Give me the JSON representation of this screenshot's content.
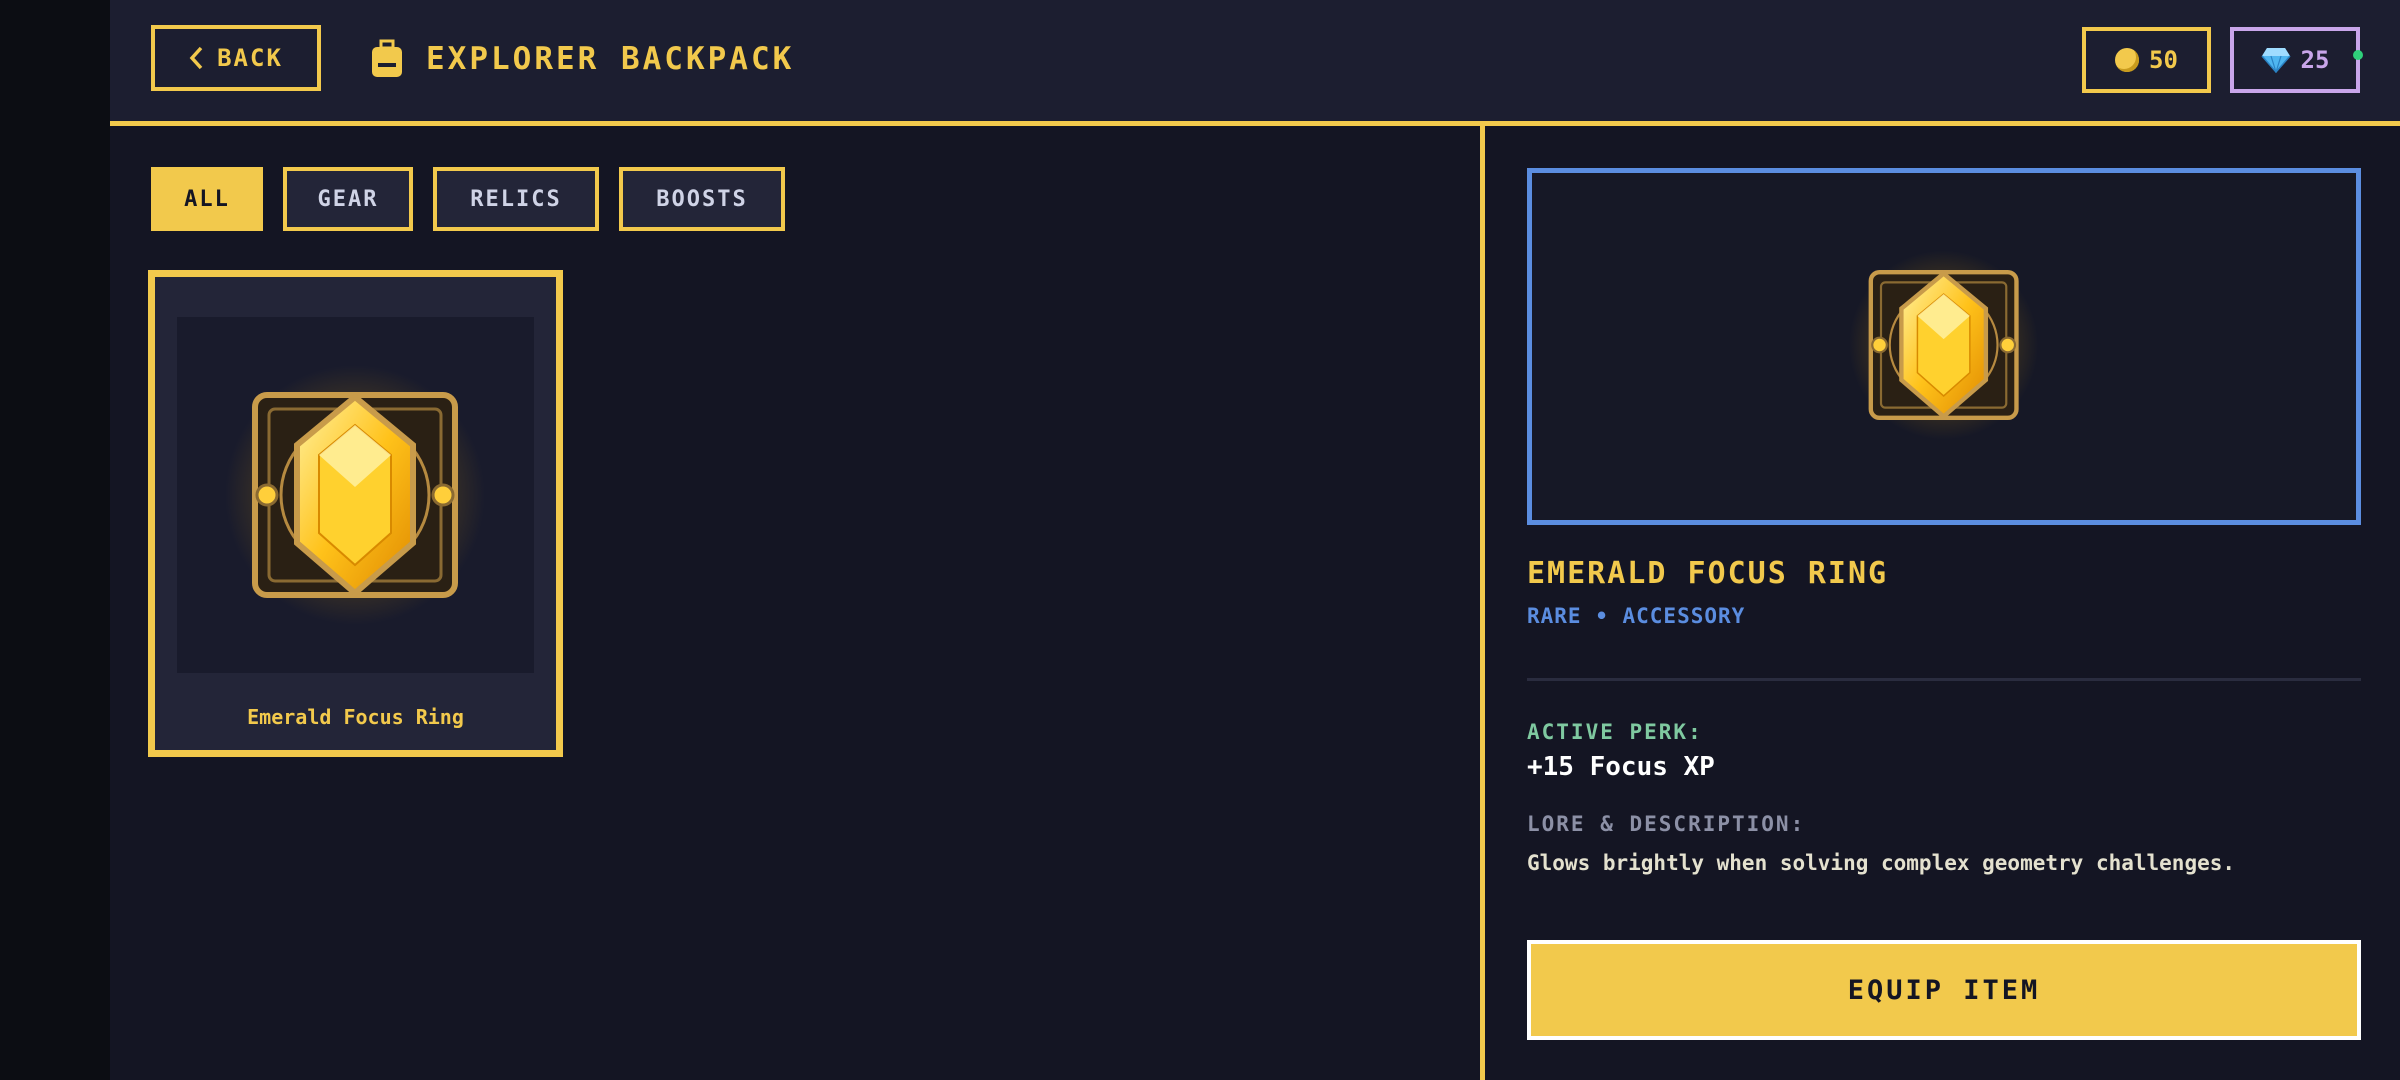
{
  "header": {
    "back_label": "BACK",
    "title": "EXPLORER BACKPACK",
    "coins": "50",
    "gems": "25"
  },
  "tabs": [
    {
      "label": "ALL",
      "active": true
    },
    {
      "label": "GEAR",
      "active": false
    },
    {
      "label": "RELICS",
      "active": false
    },
    {
      "label": "BOOSTS",
      "active": false
    }
  ],
  "inventory": [
    {
      "name": "Emerald Focus Ring",
      "icon": "golden-gem-rune-icon"
    }
  ],
  "detail": {
    "name": "EMERALD FOCUS RING",
    "meta": "RARE • ACCESSORY",
    "perk_label": "ACTIVE PERK:",
    "perk_value": "+15 Focus XP",
    "lore_label": "LORE & DESCRIPTION:",
    "lore_text": "Glows brightly when solving complex geometry challenges.",
    "equip_label": "EQUIP ITEM"
  },
  "colors": {
    "accent": "#f2c94c",
    "gem_border": "#c9a6ea",
    "rarity": "#5b8de0",
    "perk": "#7fc9a0",
    "background": "#141523"
  },
  "icons": [
    "chevron-left-icon",
    "backpack-icon",
    "coin-icon",
    "diamond-icon",
    "golden-gem-rune-icon"
  ]
}
